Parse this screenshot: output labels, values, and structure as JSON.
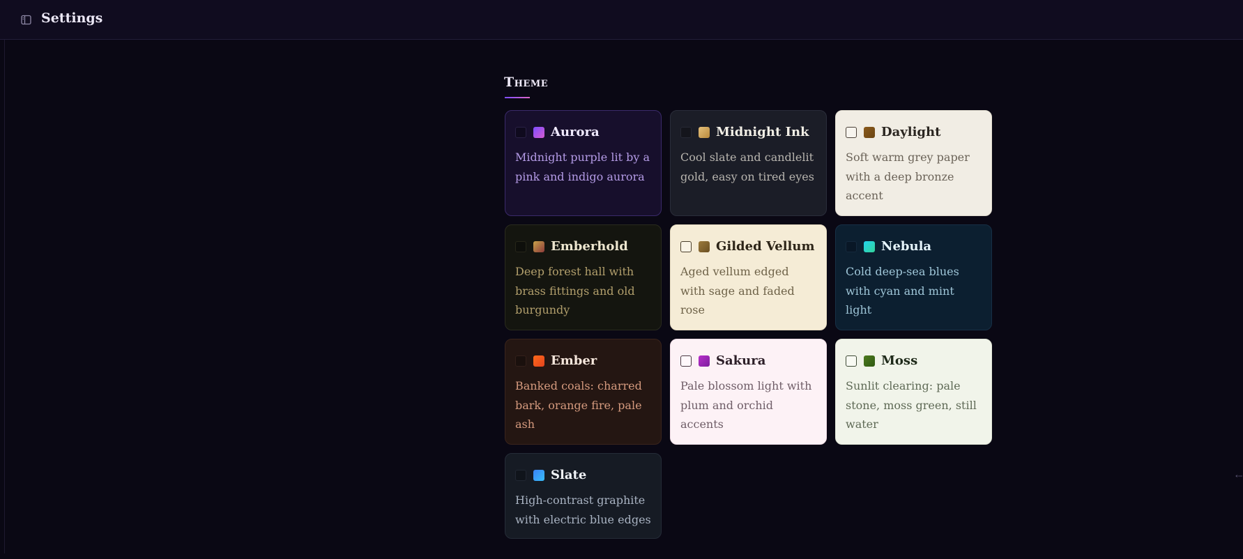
{
  "header": {
    "title": "Settings",
    "sidebar_toggle_icon": "sidebar-toggle-icon"
  },
  "theme_section": {
    "heading": "Theme",
    "accent": [
      "#7c4dff",
      "#e066c8"
    ]
  },
  "themes": [
    {
      "id": "aurora",
      "name": "Aurora",
      "description": "Midnight purple lit by a pink and indigo aurora",
      "bg": "#170f2c",
      "border": "#3b2a6b",
      "name_color": "#f0eaff",
      "desc_color": "#b49be6",
      "checkbox_bg": "#0f0a1e",
      "checkbox_border": "#2a2145",
      "swatch": [
        "#7c4dff",
        "#d65bd0"
      ]
    },
    {
      "id": "midnight-ink",
      "name": "Midnight Ink",
      "description": "Cool slate and candlelit gold, easy on tired eyes",
      "bg": "#1b1d27",
      "border": "#2a2d3a",
      "name_color": "#f2efe6",
      "desc_color": "#b7b4ae",
      "checkbox_bg": "#14151c",
      "checkbox_border": "#262834",
      "swatch": [
        "#e5c07b",
        "#b98a3c"
      ]
    },
    {
      "id": "daylight",
      "name": "Daylight",
      "description": "Soft warm grey paper with a deep bronze accent",
      "bg": "#f1ede4",
      "border": "#e1dccf",
      "name_color": "#2a2520",
      "desc_color": "#6b6358",
      "checkbox_bg": "#f7f4ee",
      "checkbox_border": "#4a4138",
      "swatch": [
        "#8a5a1c",
        "#6b4513"
      ]
    },
    {
      "id": "emberhold",
      "name": "Emberhold",
      "description": "Deep forest hall with brass fittings and old burgundy",
      "bg": "#14150f",
      "border": "#2a2b1e",
      "name_color": "#ede6cf",
      "desc_color": "#b29f6c",
      "checkbox_bg": "#0e0f0b",
      "checkbox_border": "#262619",
      "swatch": [
        "#c9a24a",
        "#8c3a3a"
      ]
    },
    {
      "id": "gilded-vellum",
      "name": "Gilded Vellum",
      "description": "Aged vellum edged with sage and faded rose",
      "bg": "#f5ecd6",
      "border": "#e6dcc2",
      "name_color": "#2d2518",
      "desc_color": "#6e6248",
      "checkbox_bg": "#faf4e6",
      "checkbox_border": "#4a3f2c",
      "swatch": [
        "#9c7a3c",
        "#6a4f22"
      ]
    },
    {
      "id": "nebula",
      "name": "Nebula",
      "description": "Cold deep-sea blues with cyan and mint light",
      "bg": "#0c1f30",
      "border": "#173046",
      "name_color": "#e6f4fb",
      "desc_color": "#9fc6d8",
      "checkbox_bg": "#091726",
      "checkbox_border": "#15293d",
      "swatch": [
        "#22d3ee",
        "#34d399"
      ]
    },
    {
      "id": "ember",
      "name": "Ember",
      "description": "Banked coals: charred bark, orange fire, pale ash",
      "bg": "#241612",
      "border": "#3a241c",
      "name_color": "#f6e7dc",
      "desc_color": "#d59a7e",
      "checkbox_bg": "#1a100d",
      "checkbox_border": "#33201a",
      "swatch": [
        "#ff6a1a",
        "#e2431e"
      ]
    },
    {
      "id": "sakura",
      "name": "Sakura",
      "description": "Pale blossom light with plum and orchid accents",
      "bg": "#fdf2f6",
      "border": "#f0dde6",
      "name_color": "#2d1f28",
      "desc_color": "#6f5d67",
      "checkbox_bg": "#fff8fb",
      "checkbox_border": "#4a3a44",
      "swatch": [
        "#b72fc9",
        "#7d1f9e"
      ]
    },
    {
      "id": "moss",
      "name": "Moss",
      "description": "Sunlit clearing: pale stone, moss green, still water",
      "bg": "#f1f4ea",
      "border": "#e0e5d6",
      "name_color": "#1f2a1a",
      "desc_color": "#5f6a56",
      "checkbox_bg": "#f8faf3",
      "checkbox_border": "#3e4a36",
      "swatch": [
        "#4d7a1f",
        "#2f5a12"
      ]
    },
    {
      "id": "slate",
      "name": "Slate",
      "description": "High-contrast graphite with electric blue edges",
      "bg": "#161b24",
      "border": "#252c38",
      "name_color": "#f1f4f8",
      "desc_color": "#a9b3c2",
      "checkbox_bg": "#10141b",
      "checkbox_border": "#212733",
      "swatch": [
        "#3b82f6",
        "#38bdf8"
      ]
    }
  ]
}
